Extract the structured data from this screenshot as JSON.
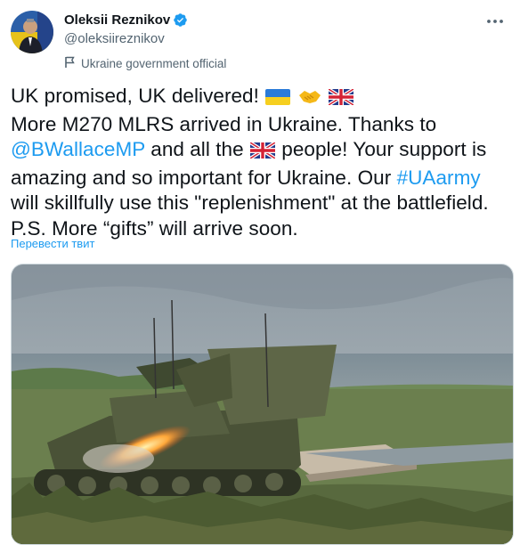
{
  "author": {
    "name": "Oleksii Reznikov",
    "handle": "@oleksiireznikov",
    "label": "Ukraine government official"
  },
  "tweet": {
    "line1": "UK promised, UK delivered!",
    "line2": "More M270 MLRS arrived in Ukraine. Thanks to",
    "mention": "@BWallaceMP",
    "line3_a": "and all the",
    "line3_b": "people! Your support is",
    "line4_a": "amazing and so important for Ukraine. Our",
    "hashtag": "#UAarmy",
    "line5": "will skillfully use this \"replenishment\" at the battlefield.",
    "line6": "P.S. More “gifts” will arrive soon."
  },
  "translate_label": "Перевести твит",
  "icons": {
    "verified": "verified-badge-icon",
    "label": "flag-icon",
    "more": "more-horizontal-icon",
    "ukraine_flag": "ukraine-flag-emoji",
    "handshake": "handshake-emoji",
    "uk_flag": "uk-flag-emoji"
  },
  "colors": {
    "link": "#1d9bf0",
    "secondary": "#536471",
    "text": "#0f1419"
  }
}
